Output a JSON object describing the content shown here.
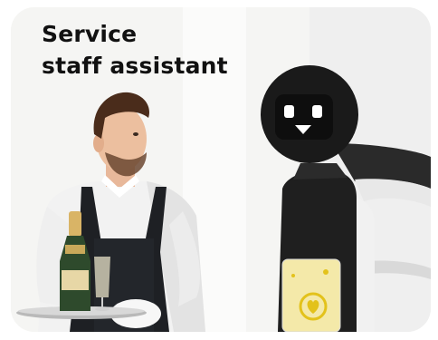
{
  "card": {
    "title_line1": "Service",
    "title_line2": "staff assistant"
  },
  "colors": {
    "background": "#f4f4f2",
    "robot_body": "#1f1f1f",
    "robot_screen": "#f4e9a9",
    "robot_logo": "#e3c21b",
    "apron": "#1e2024",
    "shirt": "#f3f3f3",
    "bottle": "#2e4a2c"
  },
  "icons": [
    "robot-face-icon",
    "heart-logo-icon"
  ]
}
